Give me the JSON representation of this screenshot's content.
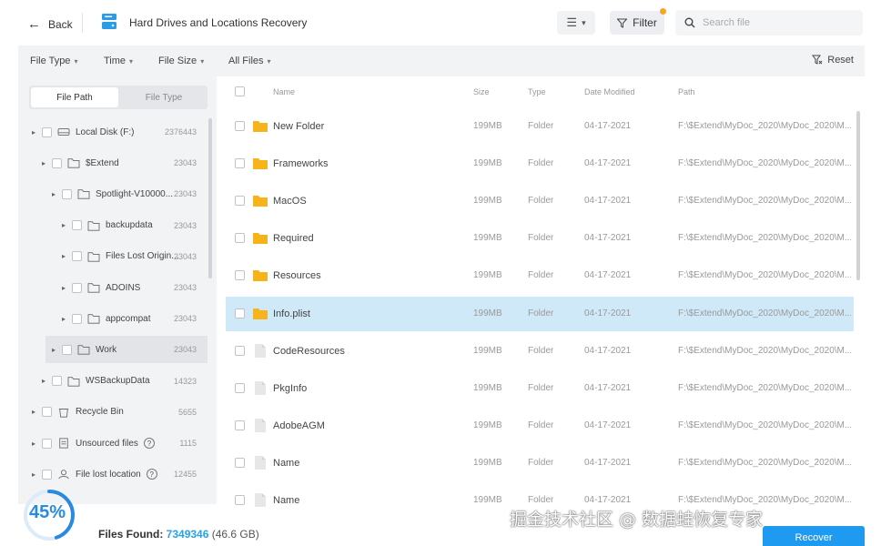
{
  "header": {
    "back_label": "Back",
    "title": "Hard Drives and Locations Recovery",
    "filter_label": "Filter",
    "search_placeholder": "Search file",
    "view_icon": "list-view-icon"
  },
  "filterbar": {
    "items": [
      "File Type",
      "Time",
      "File Size",
      "All Files"
    ],
    "reset_label": "Reset"
  },
  "sidebar": {
    "tabs": [
      "File Path",
      "File Type"
    ],
    "active_tab": "File Path",
    "tree": [
      {
        "label": "Local Disk (F:)",
        "count": "2376443",
        "level": 0,
        "icon": "hard-drive-icon"
      },
      {
        "label": "$Extend",
        "count": "23043",
        "level": 1,
        "icon": "folder-icon"
      },
      {
        "label": "Spotlight-V10000...",
        "count": "23043",
        "level": 2,
        "icon": "folder-icon"
      },
      {
        "label": "backupdata",
        "count": "23043",
        "level": 3,
        "icon": "folder-icon"
      },
      {
        "label": "Files Lost Origin...",
        "count": "23043",
        "level": 3,
        "icon": "folder-icon"
      },
      {
        "label": "ADOINS",
        "count": "23043",
        "level": 3,
        "icon": "folder-icon"
      },
      {
        "label": "appcompat",
        "count": "23043",
        "level": 3,
        "icon": "folder-icon"
      },
      {
        "label": "Work",
        "count": "23043",
        "level": 2,
        "icon": "folder-icon",
        "selected": true
      },
      {
        "label": "WSBackupData",
        "count": "14323",
        "level": 1,
        "icon": "folder-icon"
      },
      {
        "label": "Recycle Bin",
        "count": "5655",
        "level": 0,
        "icon": "recycle-bin-icon"
      },
      {
        "label": "Unsourced files",
        "count": "1115",
        "level": 0,
        "icon": "unsourced-files-icon",
        "help": true
      },
      {
        "label": "File lost location",
        "count": "12455",
        "level": 0,
        "icon": "lost-location-icon",
        "help": true
      }
    ]
  },
  "table": {
    "columns": [
      "Name",
      "Size",
      "Type",
      "Date Modified",
      "Path"
    ],
    "rows": [
      {
        "name": "New Folder",
        "size": "199MB",
        "type": "Folder",
        "date": "04-17-2021",
        "path": "F:\\$Extend\\MyDoc_2020\\MyDoc_2020\\M...",
        "kind": "folder"
      },
      {
        "name": "Frameworks",
        "size": "199MB",
        "type": "Folder",
        "date": "04-17-2021",
        "path": "F:\\$Extend\\MyDoc_2020\\MyDoc_2020\\M...",
        "kind": "folder"
      },
      {
        "name": "MacOS",
        "size": "199MB",
        "type": "Folder",
        "date": "04-17-2021",
        "path": "F:\\$Extend\\MyDoc_2020\\MyDoc_2020\\M...",
        "kind": "folder"
      },
      {
        "name": "Required",
        "size": "199MB",
        "type": "Folder",
        "date": "04-17-2021",
        "path": "F:\\$Extend\\MyDoc_2020\\MyDoc_2020\\M...",
        "kind": "folder"
      },
      {
        "name": "Resources",
        "size": "199MB",
        "type": "Folder",
        "date": "04-17-2021",
        "path": "F:\\$Extend\\MyDoc_2020\\MyDoc_2020\\M...",
        "kind": "folder"
      },
      {
        "name": "Info.plist",
        "size": "199MB",
        "type": "Folder",
        "date": "04-17-2021",
        "path": "F:\\$Extend\\MyDoc_2020\\MyDoc_2020\\M...",
        "kind": "folder",
        "selected": true
      },
      {
        "name": "CodeResources",
        "size": "199MB",
        "type": "Folder",
        "date": "04-17-2021",
        "path": "F:\\$Extend\\MyDoc_2020\\MyDoc_2020\\M...",
        "kind": "file"
      },
      {
        "name": "PkgInfo",
        "size": "199MB",
        "type": "Folder",
        "date": "04-17-2021",
        "path": "F:\\$Extend\\MyDoc_2020\\MyDoc_2020\\M...",
        "kind": "file"
      },
      {
        "name": "AdobeAGM",
        "size": "199MB",
        "type": "Folder",
        "date": "04-17-2021",
        "path": "F:\\$Extend\\MyDoc_2020\\MyDoc_2020\\M...",
        "kind": "file"
      },
      {
        "name": "Name",
        "size": "199MB",
        "type": "Folder",
        "date": "04-17-2021",
        "path": "F:\\$Extend\\MyDoc_2020\\MyDoc_2020\\M...",
        "kind": "file"
      },
      {
        "name": "Name",
        "size": "199MB",
        "type": "Folder",
        "date": "04-17-2021",
        "path": "F:\\$Extend\\MyDoc_2020\\MyDoc_2020\\M...",
        "kind": "file"
      }
    ]
  },
  "footer": {
    "progress_percent": 45,
    "progress_label": "45%",
    "files_found_label": "Files Found:",
    "files_found_count": "7349346",
    "files_found_size": "(46.6 GB)",
    "recover_label": "Recover",
    "watermark": "掘金技术社区 @ 数据蛙恢复专家"
  },
  "colors": {
    "accent": "#1e9bf0",
    "selected_row": "#cfe9f8",
    "folder": "#f6b31b",
    "progress": "#2a8ae0"
  }
}
